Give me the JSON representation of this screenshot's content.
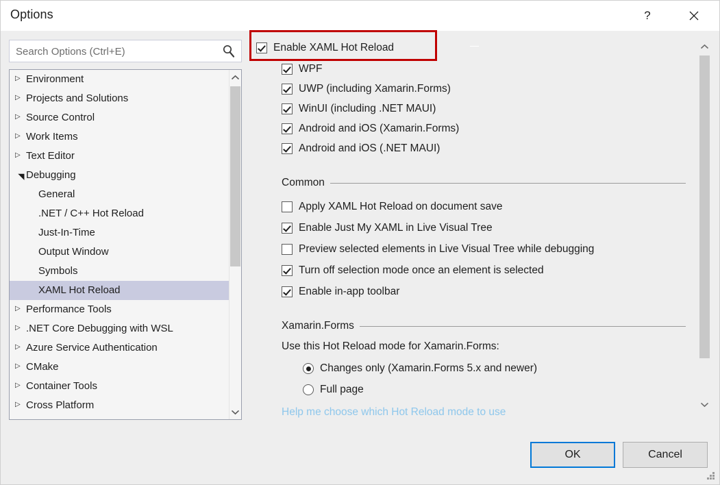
{
  "window": {
    "title": "Options",
    "help_icon": "question-mark-icon",
    "close_icon": "close-icon"
  },
  "search": {
    "placeholder": "Search Options (Ctrl+E)",
    "value": "",
    "icon": "search-icon"
  },
  "tree": {
    "items": [
      {
        "label": "Environment",
        "level": 0,
        "arrow": "collapsed",
        "selected": false
      },
      {
        "label": "Projects and Solutions",
        "level": 0,
        "arrow": "collapsed",
        "selected": false
      },
      {
        "label": "Source Control",
        "level": 0,
        "arrow": "collapsed",
        "selected": false
      },
      {
        "label": "Work Items",
        "level": 0,
        "arrow": "collapsed",
        "selected": false
      },
      {
        "label": "Text Editor",
        "level": 0,
        "arrow": "collapsed",
        "selected": false
      },
      {
        "label": "Debugging",
        "level": 0,
        "arrow": "expanded",
        "selected": false
      },
      {
        "label": "General",
        "level": 1,
        "arrow": "none",
        "selected": false
      },
      {
        "label": ".NET / C++ Hot Reload",
        "level": 1,
        "arrow": "none",
        "selected": false
      },
      {
        "label": "Just-In-Time",
        "level": 1,
        "arrow": "none",
        "selected": false
      },
      {
        "label": "Output Window",
        "level": 1,
        "arrow": "none",
        "selected": false
      },
      {
        "label": "Symbols",
        "level": 1,
        "arrow": "none",
        "selected": false
      },
      {
        "label": "XAML Hot Reload",
        "level": 1,
        "arrow": "none",
        "selected": true
      },
      {
        "label": "Performance Tools",
        "level": 0,
        "arrow": "collapsed",
        "selected": false
      },
      {
        "label": ".NET Core Debugging with WSL",
        "level": 0,
        "arrow": "collapsed",
        "selected": false
      },
      {
        "label": "Azure Service Authentication",
        "level": 0,
        "arrow": "collapsed",
        "selected": false
      },
      {
        "label": "CMake",
        "level": 0,
        "arrow": "collapsed",
        "selected": false
      },
      {
        "label": "Container Tools",
        "level": 0,
        "arrow": "collapsed",
        "selected": false
      },
      {
        "label": "Cross Platform",
        "level": 0,
        "arrow": "collapsed",
        "selected": false
      }
    ]
  },
  "options": {
    "master": {
      "label": "Enable XAML Hot Reload",
      "checked": true
    },
    "platforms": [
      {
        "label": "WPF",
        "checked": true
      },
      {
        "label": "UWP (including Xamarin.Forms)",
        "checked": true
      },
      {
        "label": "WinUI (including .NET MAUI)",
        "checked": true
      },
      {
        "label": "Android and iOS (Xamarin.Forms)",
        "checked": true
      },
      {
        "label": "Android and iOS (.NET MAUI)",
        "checked": true
      }
    ],
    "common": {
      "title": "Common",
      "items": [
        {
          "label": "Apply XAML Hot Reload on document save",
          "checked": false
        },
        {
          "label": "Enable Just My XAML in Live Visual Tree",
          "checked": true
        },
        {
          "label": "Preview selected elements in Live Visual Tree while debugging",
          "checked": false
        },
        {
          "label": "Turn off selection mode once an element is selected",
          "checked": true
        },
        {
          "label": "Enable in-app toolbar",
          "checked": true
        }
      ]
    },
    "xamarin": {
      "title": "Xamarin.Forms",
      "prompt": "Use this Hot Reload mode for Xamarin.Forms:",
      "modes": [
        {
          "label": "Changes only (Xamarin.Forms 5.x and newer)",
          "selected": true
        },
        {
          "label": "Full page",
          "selected": false
        }
      ],
      "help_link": "Help me choose which Hot Reload mode to use"
    }
  },
  "footer": {
    "ok_label": "OK",
    "cancel_label": "Cancel"
  },
  "colors": {
    "annotation": "#c00000",
    "focus": "#0078d7",
    "selection": "#c9cbe0",
    "link": "#8ec7ec"
  }
}
